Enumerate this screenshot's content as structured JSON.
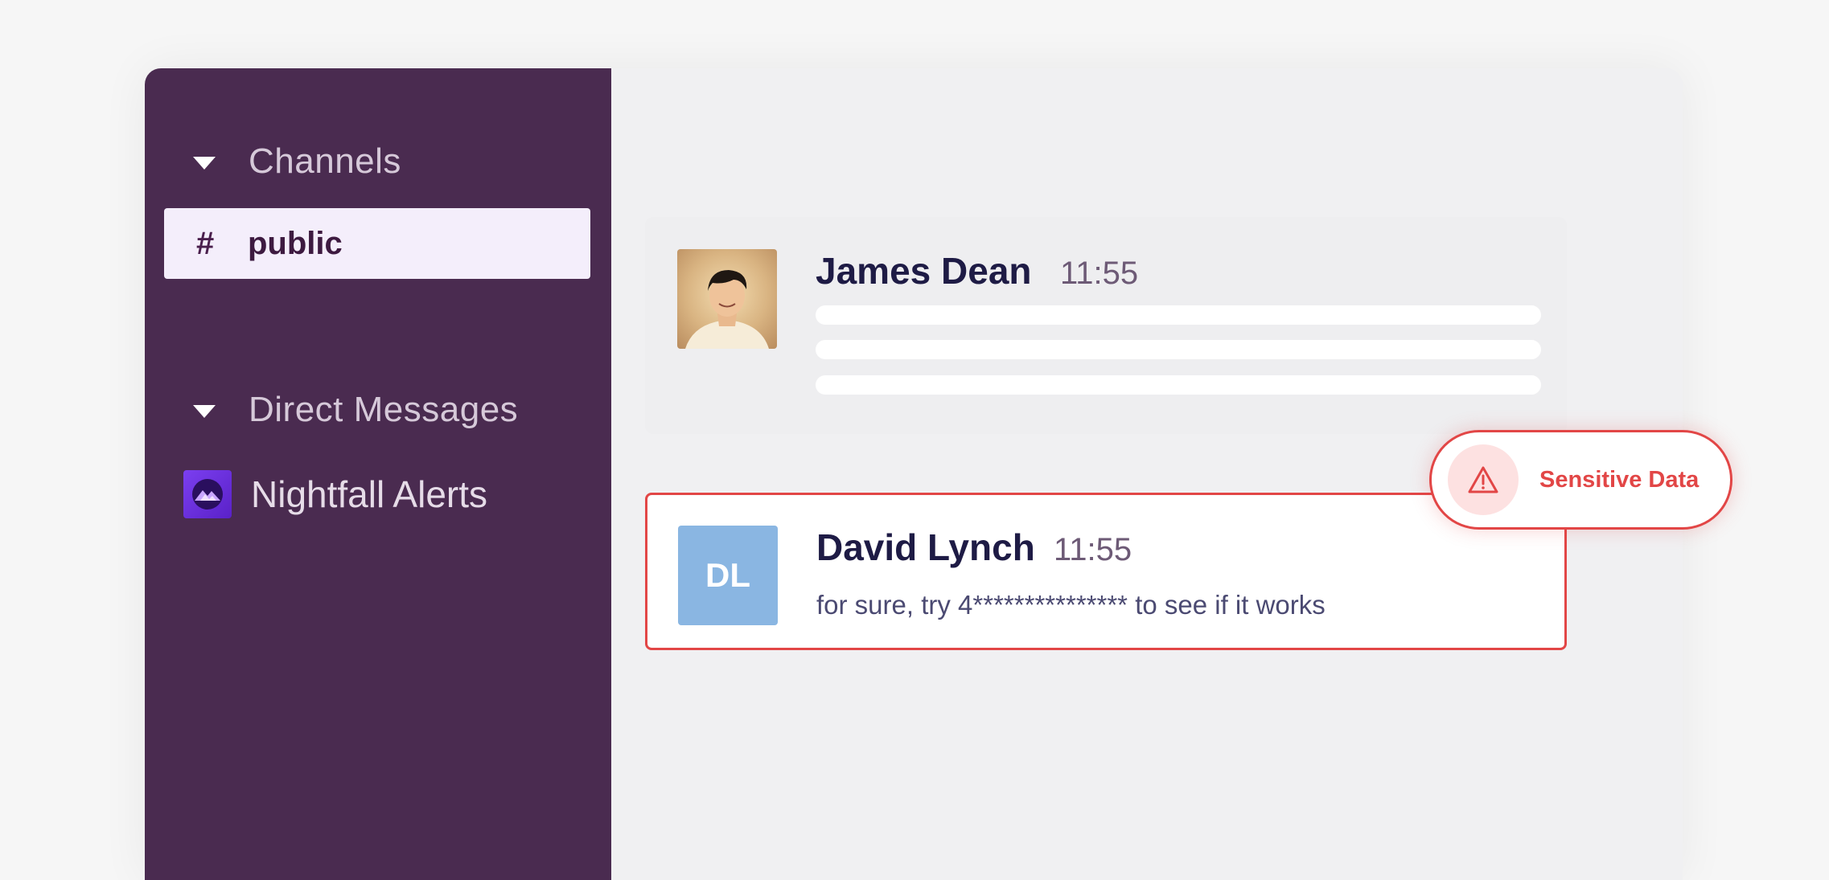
{
  "sidebar": {
    "channels_header": "Channels",
    "channels": [
      {
        "prefix": "#",
        "name": "public"
      }
    ],
    "dm_header": "Direct Messages",
    "direct_messages": [
      {
        "name": "Nightfall Alerts",
        "icon": "nightfall-app-icon"
      }
    ]
  },
  "messages": [
    {
      "author": "James Dean",
      "time": "11:55",
      "avatar": "photo-avatar"
    },
    {
      "author": "David Lynch",
      "time": "11:55",
      "initials": "DL",
      "text": "for sure, try 4*************** to see if it works",
      "flag": "Sensitive Data"
    }
  ],
  "colors": {
    "sidebar_bg": "#4a2b50",
    "alert_red": "#e24646",
    "initials_avatar_bg": "#8ab6e2"
  }
}
